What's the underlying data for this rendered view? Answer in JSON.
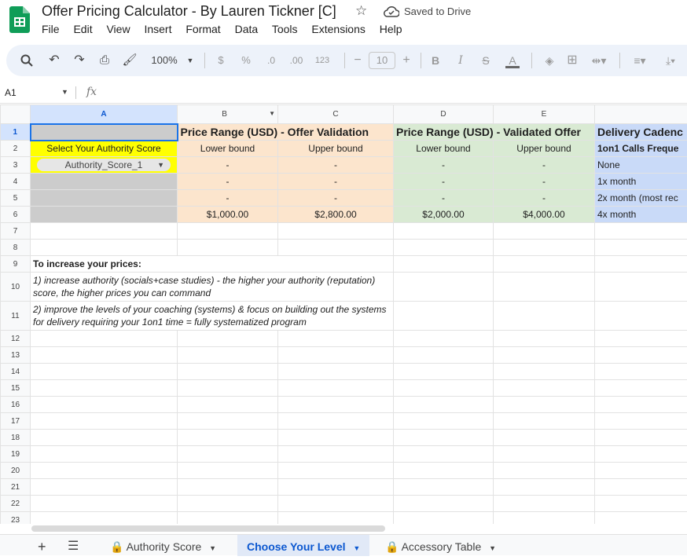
{
  "app": {
    "doc_title": "Offer Pricing Calculator - By Lauren Tickner [C]",
    "saved_status": "Saved to Drive",
    "menu": [
      "File",
      "Edit",
      "View",
      "Insert",
      "Format",
      "Data",
      "Tools",
      "Extensions",
      "Help"
    ]
  },
  "toolbar": {
    "zoom": "100%",
    "currency": "$",
    "percent": "%",
    "dec_decrease": ".0",
    "dec_increase": ".00",
    "number_format": "123",
    "font_size": "10",
    "bold": "B",
    "italic": "I"
  },
  "formula_bar": {
    "cell_ref": "A1",
    "fx": "fx",
    "value": ""
  },
  "columns": [
    "A",
    "B",
    "C",
    "D",
    "E"
  ],
  "rows": {
    "r1": {
      "b": "Price Range (USD) - Offer Validation",
      "d": "Price Range (USD) - Validated Offer",
      "f": "Delivery Cadenc"
    },
    "r2": {
      "a": "Select Your Authority Score",
      "b": "Lower bound",
      "c": "Upper bound",
      "d": "Lower bound",
      "e": "Upper bound",
      "f": "1on1 Calls Freque"
    },
    "r3": {
      "a": "Authority_Score_1",
      "b": "-",
      "c": "-",
      "d": "-",
      "e": "-",
      "f": "None"
    },
    "r4": {
      "b": "-",
      "c": "-",
      "d": "-",
      "e": "-",
      "f": "1x month"
    },
    "r5": {
      "b": "-",
      "c": "-",
      "d": "-",
      "e": "-",
      "f": "2x month (most rec"
    },
    "r6": {
      "b": "$1,000.00",
      "c": "$2,800.00",
      "d": "$2,000.00",
      "e": "$4,000.00",
      "f": "4x month"
    },
    "r9": {
      "a": "To increase your prices:"
    },
    "r10": {
      "a": "1) increase authority (socials+case studies) - the higher your authority (reputation) score, the higher prices you can command"
    },
    "r11": {
      "a": "2) improve the levels of your coaching (systems) & focus on building out the systems for delivery requiring your 1on1 time = fully systematized program"
    }
  },
  "row_numbers": [
    "1",
    "2",
    "3",
    "4",
    "5",
    "6",
    "7",
    "8",
    "9",
    "10",
    "11",
    "12",
    "13",
    "14",
    "15",
    "16",
    "17",
    "18",
    "19",
    "20",
    "21",
    "22",
    "23"
  ],
  "sheets": {
    "tabs": [
      "Authority Score",
      "Choose Your Level",
      "Accessory Table"
    ],
    "active": "Choose Your Level"
  },
  "colors": {
    "peach": "#fce5cd",
    "green": "#d9ead3",
    "blue": "#c9daf8",
    "gray": "#cccccc",
    "yellow": "#ffff00",
    "accent": "#0b57d0"
  }
}
